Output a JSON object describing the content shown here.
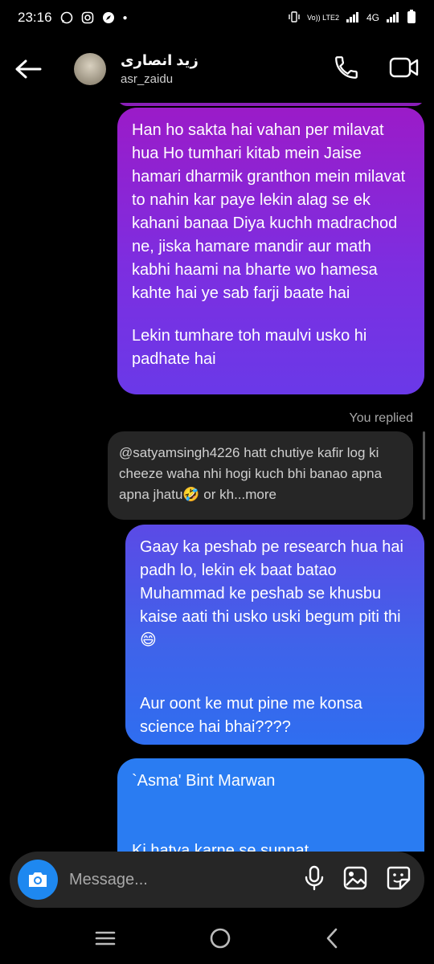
{
  "status": {
    "time": "23:16",
    "carrier": "Vo)) LTE2",
    "network": "4G"
  },
  "header": {
    "name": "زید انصاری",
    "handle": "asr_zaidu"
  },
  "messages": {
    "m1_p1": "Han ho sakta hai vahan per milavat hua Ho tumhari kitab mein Jaise hamari dharmik granthon mein milavat to nahin kar paye lekin alag se ek kahani banaa Diya kuchh madrachod ne, jiska hamare mandir aur math kabhi haami na bharte wo hamesa kahte hai ye sab farji baate hai",
    "m1_p2": "Lekin tumhare toh maulvi usko hi padhate hai",
    "replied_label": "You replied",
    "reply_quote": "@satyamsingh4226 hatt chutiye kafir log ki cheeze waha nhi hogi kuch bhi banao apna apna jhatu🤣 or kh...more",
    "m2_p1": "Gaay ka peshab pe research hua hai padh lo, lekin ek baat batao Muhammad ke peshab se khusbu kaise aati thi usko uski begum piti thi😄",
    "m2_p2": "Aur oont ke mut pine me konsa science hai bhai????",
    "m3_p1": "`Asma' Bint Marwan",
    "m3_p2": "Ki hatya karne se sunnat"
  },
  "composer": {
    "placeholder": "Message..."
  },
  "colors": {
    "accent": "#1e88f0",
    "bubble_purple": "#9b1bc8",
    "bubble_blue": "#2a7cf2"
  }
}
